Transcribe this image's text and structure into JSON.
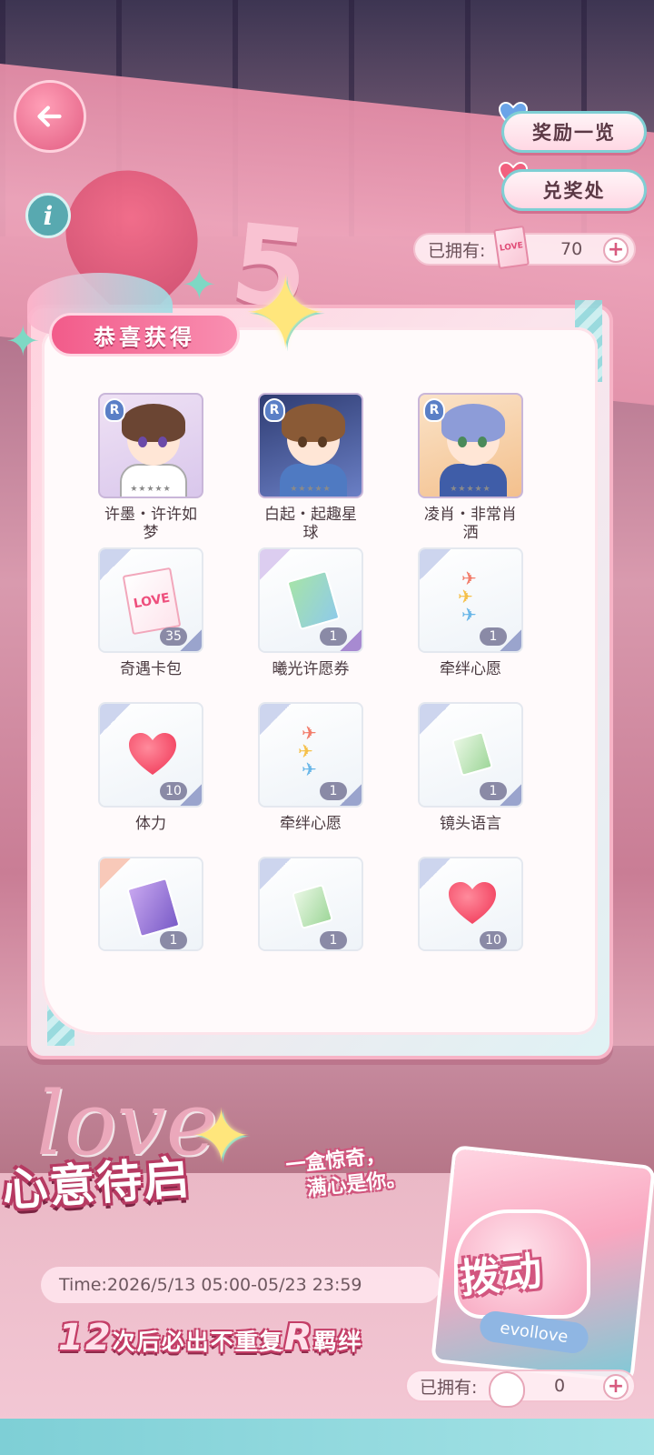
{
  "header": {
    "back_icon": "back-arrow-icon",
    "info_label": "i",
    "reward_list_label": "奖励一览",
    "redeem_label": "兑奖处",
    "owned_top": {
      "label": "已拥有:",
      "value": "70",
      "plus": "+",
      "icon": "card-pack-icon",
      "icon_text": "LOVE"
    }
  },
  "background": {
    "sign_text": "5"
  },
  "result": {
    "title": "恭喜获得",
    "rewards": [
      {
        "name": "许墨・许许如梦",
        "type": "character",
        "rarity": "R",
        "stars": "★★★★★"
      },
      {
        "name": "白起・起趣星球",
        "type": "character",
        "rarity": "R",
        "stars": "★★★★★"
      },
      {
        "name": "凌肖・非常肖洒",
        "type": "character",
        "rarity": "R",
        "stars": "★★★★★"
      },
      {
        "name": "奇遇卡包",
        "type": "card-pack",
        "qty": "35",
        "pack_text": "LOVE"
      },
      {
        "name": "曦光许愿券",
        "type": "ticket",
        "qty": "1"
      },
      {
        "name": "牵绊心愿",
        "type": "crane",
        "qty": "1"
      },
      {
        "name": "体力",
        "type": "heart",
        "qty": "10"
      },
      {
        "name": "牵绊心愿",
        "type": "crane",
        "qty": "1"
      },
      {
        "name": "镜头语言",
        "type": "book",
        "qty": "1"
      },
      {
        "name": "",
        "type": "ticket-purple",
        "qty": "1"
      },
      {
        "name": "",
        "type": "book",
        "qty": "1"
      },
      {
        "name": "",
        "type": "heart",
        "qty": "10"
      }
    ]
  },
  "event": {
    "love_text": "love",
    "title": "心意待启",
    "subtitle_line1": "一盒惊奇，",
    "subtitle_line2": "满心是你。",
    "time": "Time:2026/5/13 05:00-05/23 23:59",
    "guarantee_num": "12",
    "guarantee_text": "次后必出不重复",
    "guarantee_r": "R",
    "guarantee_tail": "羁绊",
    "draw_label": "拨动",
    "brand": "evollove",
    "owned_bottom": {
      "label": "已拥有:",
      "value": "0",
      "plus": "+"
    }
  },
  "colors": {
    "accent_pink": "#f25b8a",
    "accent_teal": "#7fcfd4",
    "heart_red": "#f2415f"
  }
}
